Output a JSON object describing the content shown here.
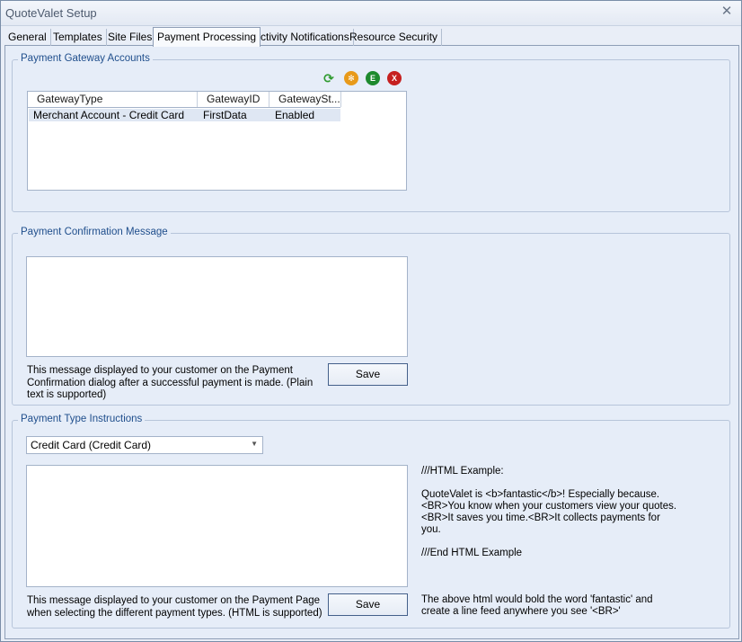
{
  "window": {
    "title": "QuoteValet Setup",
    "close_glyph": "✕"
  },
  "tabs": [
    {
      "label": "General"
    },
    {
      "label": "Templates"
    },
    {
      "label": "Site Files"
    },
    {
      "label": "Payment Processing"
    },
    {
      "label": "Activity Notifications"
    },
    {
      "label": "Resource Security"
    }
  ],
  "active_tab": "Payment Processing",
  "gateway_group": {
    "legend": "Payment Gateway Accounts",
    "toolbar": {
      "refresh_icon": "refresh-icon",
      "add_icon": "add-icon",
      "edit_label": "E",
      "delete_label": "X"
    },
    "columns": [
      "GatewayType",
      "GatewayID",
      "GatewaySt..."
    ],
    "rows": [
      {
        "type": "Merchant Account - Credit Card",
        "id": "FirstData",
        "status": "Enabled"
      }
    ]
  },
  "confirmation_group": {
    "legend": "Payment Confirmation Message",
    "message_value": "",
    "help": "This message displayed to your customer on the Payment Confirmation dialog after a successful payment is made. (Plain text is supported)",
    "save_label": "Save"
  },
  "instructions_group": {
    "legend": "Payment Type Instructions",
    "selected_type": "Credit Card (Credit Card)",
    "instructions_value": "",
    "help": "This message displayed to your customer on the Payment Page when selecting the different payment types. (HTML is supported)",
    "save_label": "Save",
    "example_start": "///HTML Example:",
    "example_body": "QuoteValet is <b>fantastic</b>! Especially because.<BR>You know when your customers view your quotes.<BR>It saves you time.<BR>It collects payments for you.",
    "example_end": "///End HTML Example",
    "example_note": "The above html would bold the word 'fantastic' and create a line feed anywhere you see '<BR>'"
  },
  "colors": {
    "refresh": "#2e9a2e",
    "add": "#e89a1a",
    "edit": "#1e8a2e",
    "delete": "#c62020"
  }
}
